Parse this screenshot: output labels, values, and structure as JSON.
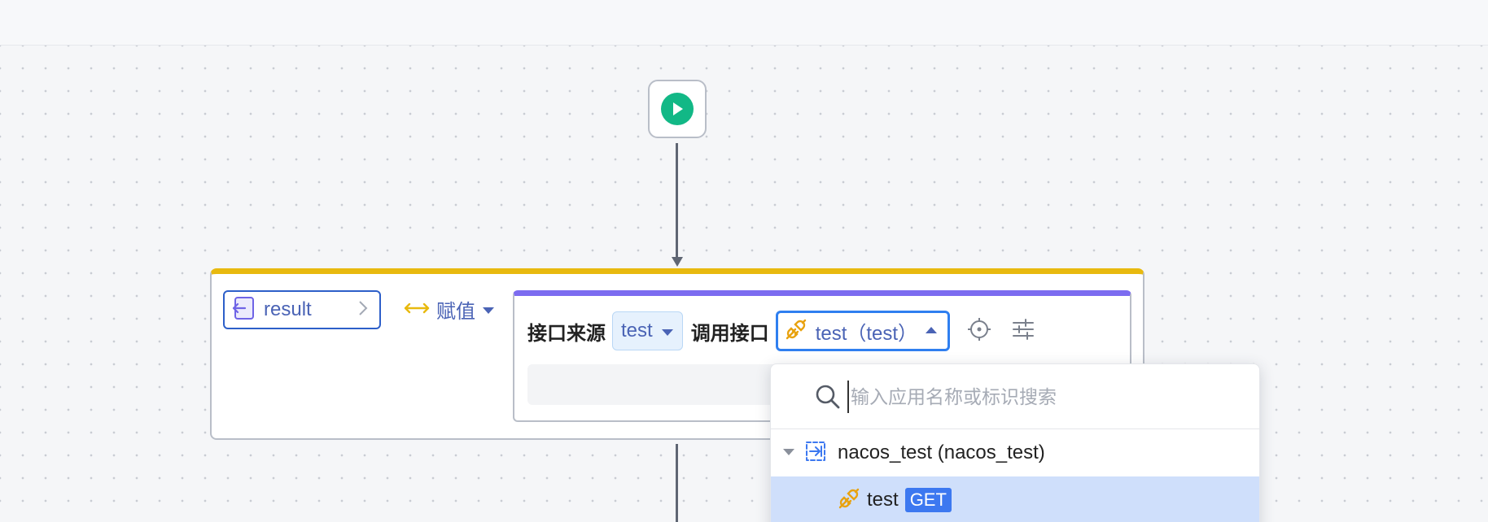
{
  "assign": {
    "target_label": "result",
    "operator_label": "赋值"
  },
  "api_call": {
    "source_label": "接口来源",
    "source_value": "test",
    "call_label": "调用接口",
    "call_value": "test（test）"
  },
  "dropdown": {
    "search_placeholder": "输入应用名称或标识搜索",
    "groups": [
      {
        "name": "nacos_test (nacos_test)",
        "expanded": true,
        "items": [
          {
            "name": "test",
            "method": "GET",
            "selected": true
          }
        ]
      }
    ]
  },
  "colors": {
    "start_green": "#12b886",
    "assign_accent": "#e8b90f",
    "api_accent": "#7c6cf0",
    "focus_blue": "#2f7ff0",
    "method_badge": "#3c78f0",
    "selected_row": "#cfdffb"
  },
  "icons": [
    "play-icon",
    "variable-icon",
    "chevron-right-icon",
    "assign-arrow-icon",
    "caret-down-icon",
    "plug-icon",
    "caret-up-icon",
    "locate-icon",
    "settings-sliders-icon",
    "search-icon",
    "app-icon"
  ]
}
